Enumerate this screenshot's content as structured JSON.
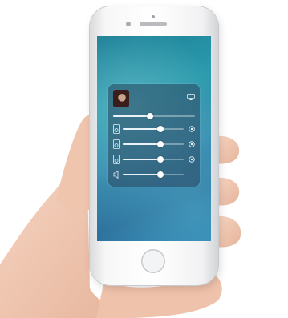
{
  "colors": {
    "background": "#ffffff",
    "skin": "#f2c9b3",
    "skin_shadow": "#e2ad95",
    "phone_body": "#f5f5f6",
    "screen_accent": "#2a9aac",
    "panel": "#28465f"
  },
  "icons": {
    "album_art": "album-art-portrait",
    "output": "airplay-icon",
    "device": "speaker-icon",
    "device_end": "volume-icon"
  },
  "audio_panel": {
    "now_playing": {
      "title": "",
      "artist": ""
    },
    "master_volume": 0.45,
    "devices": [
      {
        "level": 0.62
      },
      {
        "level": 0.62
      },
      {
        "level": 0.62
      },
      {
        "level": 0.62
      }
    ]
  }
}
